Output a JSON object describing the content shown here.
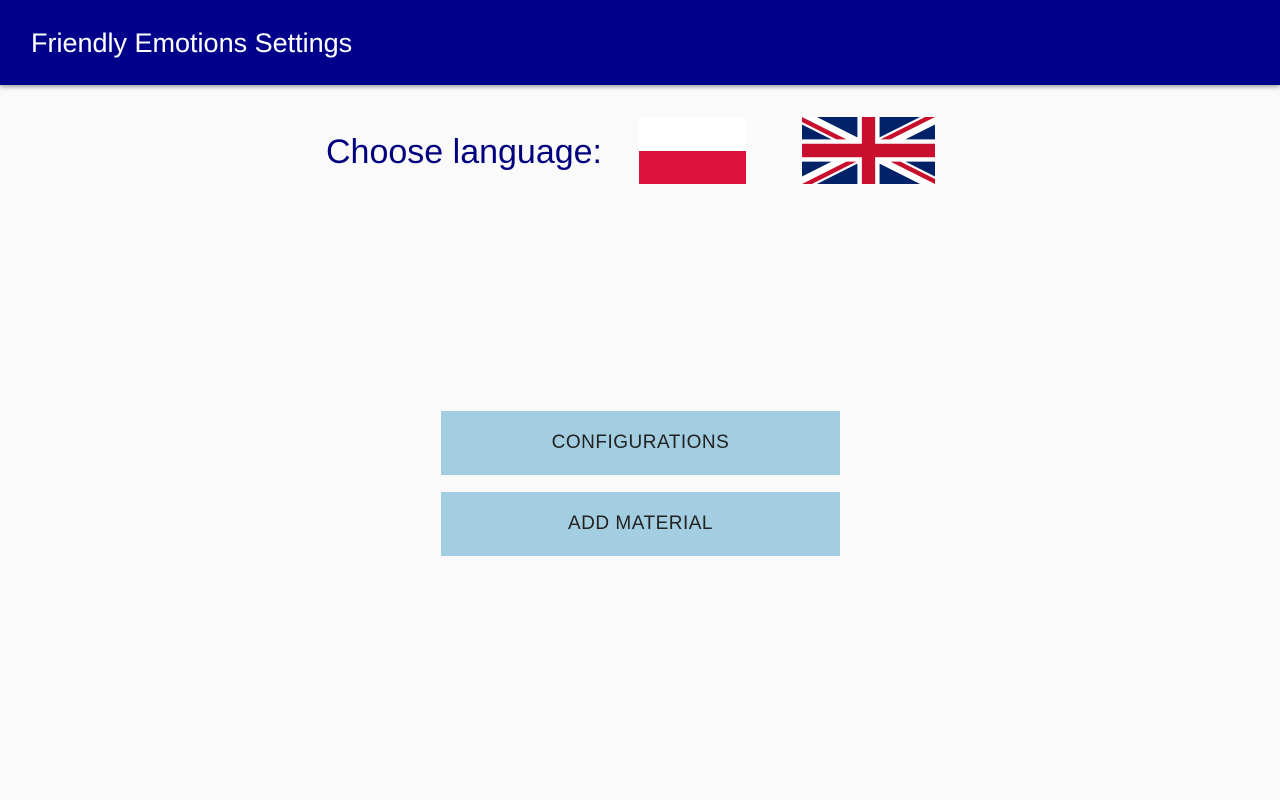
{
  "appbar": {
    "title": "Friendly Emotions Settings"
  },
  "language": {
    "label": "Choose language:",
    "options": [
      {
        "code": "pl",
        "icon": "poland-flag-icon"
      },
      {
        "code": "en",
        "icon": "uk-flag-icon"
      }
    ]
  },
  "buttons": {
    "configurations": "CONFIGURATIONS",
    "add_material": "ADD MATERIAL"
  },
  "colors": {
    "appbar": "#00008b",
    "accent_text": "#00007f",
    "button_bg": "#a3cde0",
    "background": "#fafafa"
  }
}
